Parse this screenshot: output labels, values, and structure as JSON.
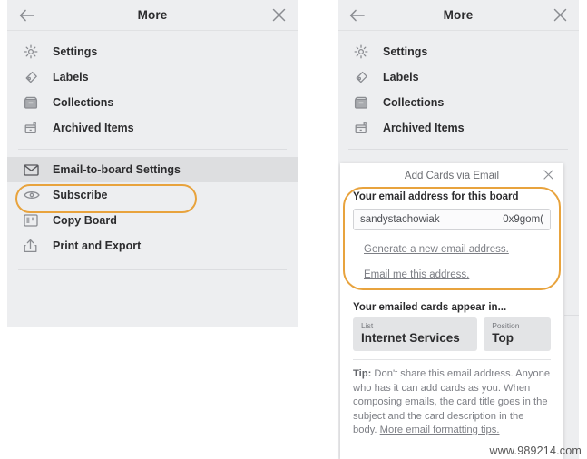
{
  "left_panel": {
    "header": {
      "back_icon": "arrow-left-icon",
      "title": "More",
      "close_icon": "close-icon"
    },
    "items": [
      {
        "icon": "gear-icon",
        "label": "Settings"
      },
      {
        "icon": "tag-icon",
        "label": "Labels"
      },
      {
        "icon": "box-icon",
        "label": "Collections"
      },
      {
        "icon": "archive-icon",
        "label": "Archived Items"
      }
    ],
    "items2": [
      {
        "icon": "envelope-icon",
        "label": "Email-to-board Settings",
        "selected": true
      },
      {
        "icon": "eye-icon",
        "label": "Subscribe"
      },
      {
        "icon": "board-icon",
        "label": "Copy Board"
      },
      {
        "icon": "share-icon",
        "label": "Print and Export"
      }
    ]
  },
  "right_panel": {
    "header": {
      "back_icon": "arrow-left-icon",
      "title": "More",
      "close_icon": "close-icon"
    },
    "items": [
      {
        "icon": "gear-icon",
        "label": "Settings"
      },
      {
        "icon": "tag-icon",
        "label": "Labels"
      },
      {
        "icon": "box-icon",
        "label": "Collections"
      },
      {
        "icon": "archive-icon",
        "label": "Archived Items"
      }
    ],
    "popup": {
      "title": "Add Cards via Email",
      "close_icon": "close-icon",
      "email_section_label": "Your email address for this board",
      "email_value_left": "sandystachowiak",
      "email_value_right": "0x9gom(",
      "generate_link": "Generate a new email address.",
      "email_me_link": "Email me this address.",
      "appear_label": "Your emailed cards appear in...",
      "list_caption": "List",
      "list_value": "Internet Services",
      "position_caption": "Position",
      "position_value": "Top",
      "tip_prefix": "Tip:",
      "tip_text": " Don't share this email address. Anyone who has it can add cards as you. When composing emails, the card title goes in the subject and the card description in the body. ",
      "tip_link": "More email formatting tips."
    }
  },
  "watermark": "www.989214.com",
  "colors": {
    "panel_bg": "#edeef0",
    "selected_row": "#dddee0",
    "highlight_ring": "#e8a33d",
    "text_primary": "#2c2c2e",
    "text_muted": "#7d7f85"
  }
}
